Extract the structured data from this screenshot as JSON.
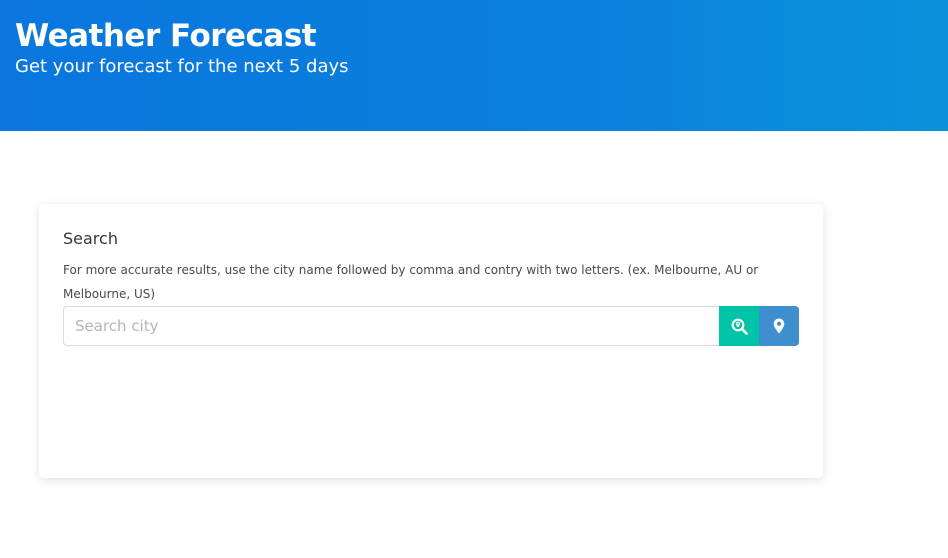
{
  "header": {
    "title": "Weather Forecast",
    "subtitle": "Get your forecast for the next 5 days"
  },
  "search": {
    "title": "Search",
    "help": "For more accurate results, use the city name followed by comma and contry with two letters. (ex. Melbourne, AU or Melbourne, US)",
    "placeholder": "Search city",
    "value": "",
    "search_button_icon": "search-location-icon",
    "locate_button_icon": "map-marker-icon"
  },
  "colors": {
    "header_gradient_start": "#0a76de",
    "header_gradient_end": "#0a93db",
    "search_button": "#00c4a7",
    "locate_button": "#3e8ed0"
  }
}
